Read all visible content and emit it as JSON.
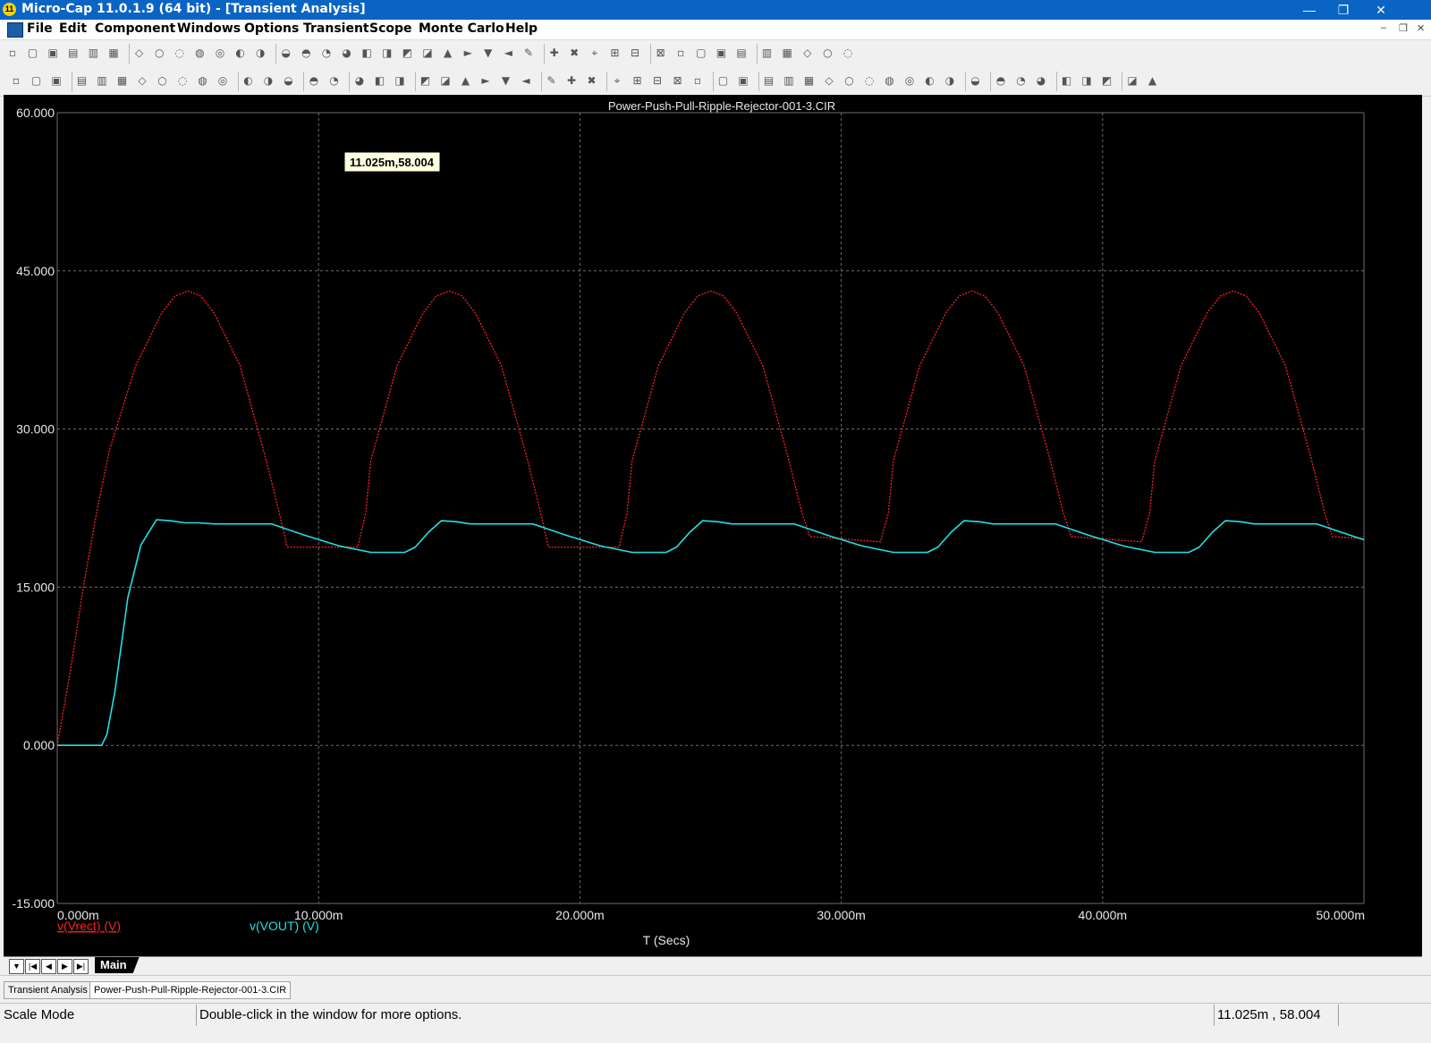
{
  "window": {
    "title": "Micro-Cap 11.0.1.9 (64 bit) - [Transient Analysis]",
    "app_icon": "micro-cap-logo-icon"
  },
  "menu": [
    "File",
    "Edit",
    "Component",
    "Windows",
    "Options",
    "Transient",
    "Scope",
    "Monte Carlo",
    "Help"
  ],
  "toolbar1_icons": [
    "new",
    "open",
    "save",
    "save-all",
    "print-preview",
    "print",
    "undo",
    "redo",
    "cut",
    "copy",
    "paste",
    "delete",
    "select-all",
    "ground",
    "source",
    "capacitor",
    "resistor",
    "inductor",
    "diode",
    "npn",
    "battery",
    "transformer",
    "switch",
    "voltage-source",
    "current-source",
    "cascade",
    "tile-vertical",
    "tile-horizontal",
    "split",
    "window",
    "calculator",
    "blank",
    "analysis",
    "globe",
    "import",
    "export",
    "probe",
    "dc-op",
    "tools",
    "graph",
    "properties"
  ],
  "toolbar2_icons": [
    "pointer",
    "select-region",
    "dropdown",
    "rectangle",
    "ellipse",
    "diamond",
    "arrow",
    "curve",
    "formula",
    "text",
    "info",
    "run",
    "stop",
    "pause",
    "scale-x",
    "scale-y",
    "grid",
    "minor-grid",
    "shade",
    "shade2",
    "shade3",
    "shade4",
    "hdivide",
    "vdivide",
    "zoom-box",
    "zoom-fit",
    "zoom-in-x",
    "zoom-out-x",
    "properties",
    "cursor-mode",
    "tangent",
    "peak",
    "valley",
    "high",
    "low",
    "slope",
    "global-high",
    "global-low",
    "inflection",
    "lock",
    "paste",
    "dropdown",
    "page",
    "data-points",
    "tokens",
    "fit",
    "zoom-in",
    "zoom-out",
    "zoom-prev",
    "layout",
    "dropdown",
    "font",
    "copy-graph",
    "paste-graph"
  ],
  "plot": {
    "title": "Power-Push-Pull-Ripple-Rejector-001-3.CIR",
    "tooltip": "11.025m,58.004",
    "background": "#000000",
    "grid_color": "#6e6e6e"
  },
  "chart_data": {
    "type": "line",
    "title": "Power-Push-Pull-Ripple-Rejector-001-3.CIR",
    "xlabel": "T (Secs)",
    "ylabel": "",
    "xlim": [
      0,
      0.05
    ],
    "ylim": [
      -15,
      60
    ],
    "grid": true,
    "x_tick_labels": [
      "0.000m",
      "10.000m",
      "20.000m",
      "30.000m",
      "40.000m",
      "50.000m"
    ],
    "y_tick_labels": [
      "60.000",
      "45.000",
      "30.000",
      "15.000",
      "0.000",
      "-15.000"
    ],
    "series": [
      {
        "name": "v(Vrect) (V)",
        "color": "#ff2020",
        "style": "dotted",
        "x": [
          0,
          0.0005,
          0.001,
          0.0015,
          0.002,
          0.003,
          0.004,
          0.0045,
          0.005,
          0.0055,
          0.006,
          0.007,
          0.0075,
          0.008,
          0.0085,
          0.0088,
          0.0115,
          0.0118,
          0.012,
          0.013,
          0.014,
          0.0145,
          0.015,
          0.0155,
          0.016,
          0.017,
          0.0175,
          0.018,
          0.0185,
          0.0188,
          0.0215,
          0.0218,
          0.022,
          0.023,
          0.024,
          0.0245,
          0.025,
          0.0255,
          0.026,
          0.027,
          0.0275,
          0.028,
          0.0285,
          0.0288,
          0.0315,
          0.0318,
          0.032,
          0.033,
          0.034,
          0.0345,
          0.035,
          0.0355,
          0.036,
          0.037,
          0.0375,
          0.038,
          0.0385,
          0.0388,
          0.0415,
          0.0418,
          0.042,
          0.043,
          0.044,
          0.0445,
          0.045,
          0.0455,
          0.046,
          0.047,
          0.0475,
          0.048,
          0.0485,
          0.0488,
          0.05
        ],
        "values": [
          0,
          7,
          15,
          22,
          28,
          36,
          41,
          42.6,
          43.1,
          42.6,
          41,
          36,
          31.5,
          27,
          22,
          18.8,
          18.8,
          22,
          27,
          36,
          41,
          42.6,
          43.1,
          42.6,
          41,
          36,
          31.5,
          27,
          22,
          18.8,
          18.8,
          22,
          27,
          36,
          41,
          42.6,
          43.1,
          42.6,
          41,
          36,
          31.5,
          27,
          22,
          19.8,
          19.3,
          22,
          27,
          36,
          41,
          42.6,
          43.1,
          42.6,
          41,
          36,
          31.5,
          27,
          22,
          19.8,
          19.3,
          22,
          27,
          36,
          41,
          42.6,
          43.1,
          42.6,
          41,
          36,
          31.5,
          27,
          22,
          19.8,
          19.6
        ]
      },
      {
        "name": "v(VOUT) (V)",
        "color": "#20e0e8",
        "style": "solid",
        "x": [
          0,
          0.0017,
          0.0019,
          0.0022,
          0.0027,
          0.0032,
          0.0038,
          0.0043,
          0.0049,
          0.0054,
          0.006,
          0.0082,
          0.0095,
          0.0108,
          0.012,
          0.0133,
          0.0137,
          0.0142,
          0.0147,
          0.0153,
          0.0158,
          0.016,
          0.0182,
          0.0195,
          0.0208,
          0.022,
          0.0233,
          0.0237,
          0.0242,
          0.0247,
          0.0253,
          0.0258,
          0.026,
          0.0282,
          0.0295,
          0.0308,
          0.032,
          0.0333,
          0.0337,
          0.0342,
          0.0347,
          0.0353,
          0.0358,
          0.036,
          0.0382,
          0.0395,
          0.0408,
          0.042,
          0.0433,
          0.0437,
          0.0442,
          0.0447,
          0.0453,
          0.0458,
          0.046,
          0.0482,
          0.0495,
          0.05
        ],
        "values": [
          0,
          0,
          1,
          5,
          14,
          19,
          21.4,
          21.3,
          21.1,
          21.1,
          21.0,
          21.0,
          19.9,
          18.9,
          18.3,
          18.3,
          18.8,
          20.2,
          21.3,
          21.2,
          21.0,
          21.0,
          21.0,
          19.9,
          18.9,
          18.3,
          18.3,
          18.8,
          20.2,
          21.3,
          21.2,
          21.0,
          21.0,
          21.0,
          19.9,
          18.9,
          18.3,
          18.3,
          18.8,
          20.2,
          21.3,
          21.2,
          21.0,
          21.0,
          21.0,
          19.9,
          18.9,
          18.3,
          18.3,
          18.8,
          20.2,
          21.3,
          21.2,
          21.0,
          21.0,
          21.0,
          19.9,
          19.5
        ]
      }
    ]
  },
  "tabs": {
    "nav_icons": [
      "tab-dropdown-icon",
      "tab-first-icon",
      "tab-prev-icon",
      "tab-next-icon",
      "tab-last-icon"
    ],
    "active": "Main"
  },
  "document_tabs": [
    "Transient Analysis",
    "Power-Push-Pull-Ripple-Rejector-001-3.CIR"
  ],
  "status": {
    "mode": "Scale Mode",
    "hint": "Double-click in the window for more options.",
    "coords": "11.025m , 58.004"
  }
}
